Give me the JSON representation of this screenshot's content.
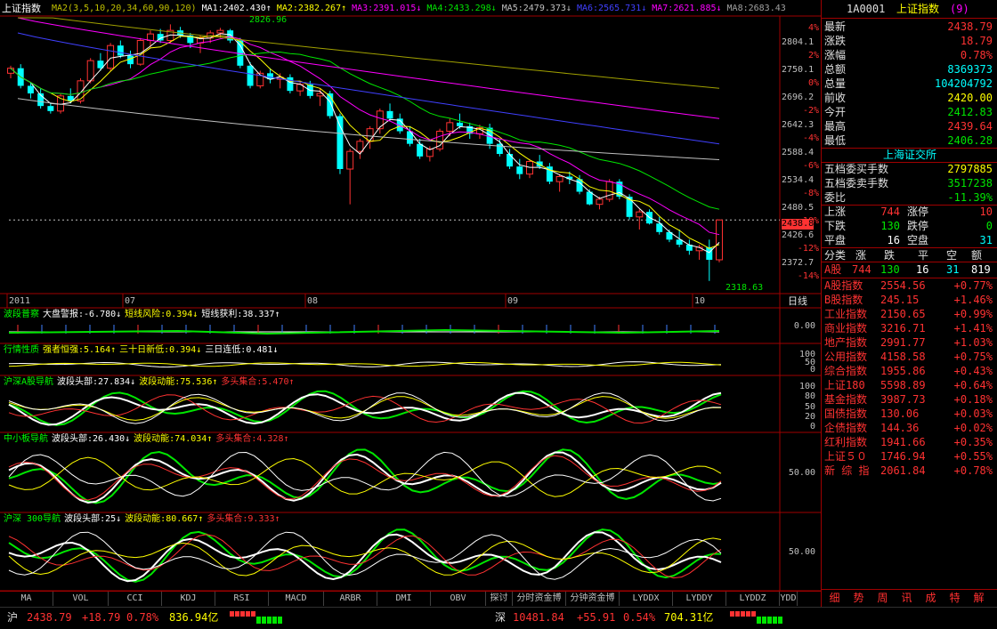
{
  "colors": {
    "up": "#ff3232",
    "down": "#00ffff",
    "green": "#00e600",
    "white": "#ffffff",
    "yellow": "#ffff00",
    "label": "#e0e0e0",
    "grid": "#a00000"
  },
  "header": {
    "title": "上证指数",
    "ma_legend": [
      {
        "text": "MA2(3,5,10,20,34,60,90,120)",
        "color": "#c0c000"
      },
      {
        "text": "MA1:2402.430↑",
        "color": "#ffffff"
      },
      {
        "text": "MA2:2382.267↑",
        "color": "#ffff00"
      },
      {
        "text": "MA3:2391.015↓",
        "color": "#ff00ff"
      },
      {
        "text": "MA4:2433.298↓",
        "color": "#00e600"
      },
      {
        "text": "MA5:2479.373↓",
        "color": "#c0c0c0"
      },
      {
        "text": "MA6:2565.731↓",
        "color": "#4040ff"
      },
      {
        "text": "MA7:2621.885↓",
        "color": "#ff00ff"
      },
      {
        "text": "MA8:2683.43",
        "color": "#a0a0a0"
      }
    ]
  },
  "price_axis": {
    "ticks": [
      {
        "price": "2804.1",
        "pct": "4%"
      },
      {
        "price": "2750.1",
        "pct": "2%"
      },
      {
        "price": "2696.2",
        "pct": "0%"
      },
      {
        "price": "2642.3",
        "pct": "-2%"
      },
      {
        "price": "2588.4",
        "pct": "-4%"
      },
      {
        "price": "2534.4",
        "pct": "-6%"
      },
      {
        "price": "2480.5",
        "pct": "-8%"
      },
      {
        "price": "2426.6",
        "pct": "-10%"
      },
      {
        "price": "2372.7",
        "pct": "-12%"
      },
      {
        "pct": "-14%"
      }
    ],
    "current": "2438.8",
    "high_label": "2826.96",
    "low_label": "2318.63"
  },
  "date_axis": [
    "2011",
    "07",
    "08",
    "09",
    "10"
  ],
  "period": "日线",
  "subcharts": [
    {
      "id": "wave",
      "legend": [
        {
          "text": "波段普察",
          "color": "#00ff00"
        },
        {
          "text": "大盘警报:-6.780↓",
          "color": "#ffffff"
        },
        {
          "text": "短线风险:0.394↓",
          "color": "#ffff00"
        },
        {
          "text": "短线获利:38.337↑",
          "color": "#ffffff"
        }
      ],
      "axis": [
        "0.00"
      ]
    },
    {
      "id": "nature",
      "legend": [
        {
          "text": "行情性质",
          "color": "#00ff00"
        },
        {
          "text": "强者恒强:5.164↑",
          "color": "#ffff00"
        },
        {
          "text": "三十日新低:0.394↓",
          "color": "#ffff00"
        },
        {
          "text": "三日连低:0.481↓",
          "color": "#ffffff"
        }
      ],
      "axis": [
        "100",
        "50",
        "0"
      ]
    },
    {
      "id": "hs_a",
      "legend": [
        {
          "text": "沪深A股导航",
          "color": "#00ff00"
        },
        {
          "text": "波段头部:27.834↓",
          "color": "#ffffff"
        },
        {
          "text": "波段动能:75.536↑",
          "color": "#ffff00"
        },
        {
          "text": "多头集合:5.470↑",
          "color": "#ff3232"
        }
      ],
      "axis": [
        "100",
        "80",
        "50",
        "20",
        "0"
      ]
    },
    {
      "id": "sme",
      "legend": [
        {
          "text": "中小板导航",
          "color": "#00ff00"
        },
        {
          "text": "波段头部:26.430↓",
          "color": "#ffffff"
        },
        {
          "text": "波段动能:74.034↑",
          "color": "#ffff00"
        },
        {
          "text": "多头集合:4.328↑",
          "color": "#ff3232"
        }
      ],
      "axis": [
        "50.00"
      ]
    },
    {
      "id": "hs300",
      "legend": [
        {
          "text": "沪深 300导航",
          "color": "#00ff00"
        },
        {
          "text": "波段头部:25↓",
          "color": "#ffffff"
        },
        {
          "text": "波段动能:80.667↑",
          "color": "#ffff00"
        },
        {
          "text": "多头集合:9.333↑",
          "color": "#ff3232"
        }
      ],
      "axis": [
        "50.00"
      ]
    }
  ],
  "bottom_tabs": [
    "MA",
    "VOL",
    "CCI",
    "KDJ",
    "RSI",
    "MACD",
    "ARBR",
    "DMI",
    "OBV",
    "探讨",
    "分时资金博",
    "分钟资金博",
    "LYDDX",
    "LYDDY",
    "LYDDZ",
    "YDD"
  ],
  "right_panel": {
    "code": "1A0001",
    "name": "上证指数",
    "badge": "(9)",
    "quote": [
      {
        "label": "最新",
        "value": "2438.79",
        "color": "#ff3232"
      },
      {
        "label": "涨跌",
        "value": "18.79",
        "color": "#ff3232"
      },
      {
        "label": "涨幅",
        "value": "0.78%",
        "color": "#ff3232"
      },
      {
        "label": "总额",
        "value": "8369373",
        "color": "#00ffff"
      },
      {
        "label": "总量",
        "value": "104204792",
        "color": "#00ffff"
      },
      {
        "label": "前收",
        "value": "2420.00",
        "color": "#ffff00"
      },
      {
        "label": "今开",
        "value": "2412.83",
        "color": "#00e600"
      },
      {
        "label": "最高",
        "value": "2439.64",
        "color": "#ff3232"
      },
      {
        "label": "最低",
        "value": "2406.28",
        "color": "#00e600"
      }
    ],
    "exchange_title": "上海证交所",
    "orders": [
      {
        "label": "五档委买手数",
        "value": "2797885",
        "color": "#ffff00"
      },
      {
        "label": "五档委卖手数",
        "value": "3517238",
        "color": "#00e600"
      },
      {
        "label": "委比",
        "value": "-11.39%",
        "color": "#00e600"
      }
    ],
    "breadth": [
      {
        "l1": "上涨",
        "v1": "744",
        "l2": "涨停",
        "v2": "10",
        "c1": "#ff3232",
        "c2": "#ff3232"
      },
      {
        "l1": "下跌",
        "v1": "130",
        "l2": "跌停",
        "v2": "0",
        "c1": "#00e600",
        "c2": "#00e600"
      },
      {
        "l1": "平盘",
        "v1": "16",
        "l2": "空盘",
        "v2": "31",
        "c1": "#ffffff",
        "c2": "#00ffff"
      }
    ],
    "class_header": [
      "分类",
      "涨",
      "跌",
      "平",
      "空",
      "额"
    ],
    "class_row": {
      "name": "A股",
      "up": "744",
      "down": "130",
      "flat": "16",
      "empty": "31",
      "amt": "819"
    },
    "indices": [
      {
        "name": "A股指数",
        "value": "2554.56",
        "chg": "+0.77%"
      },
      {
        "name": "B股指数",
        "value": "245.15",
        "chg": "+1.46%"
      },
      {
        "name": "工业指数",
        "value": "2150.65",
        "chg": "+0.99%"
      },
      {
        "name": "商业指数",
        "value": "3216.71",
        "chg": "+1.41%"
      },
      {
        "name": "地产指数",
        "value": "2991.77",
        "chg": "+1.03%"
      },
      {
        "name": "公用指数",
        "value": "4158.58",
        "chg": "+0.75%"
      },
      {
        "name": "综合指数",
        "value": "1955.86",
        "chg": "+0.43%"
      },
      {
        "name": "上证180",
        "value": "5598.89",
        "chg": "+0.64%"
      },
      {
        "name": "基金指数",
        "value": "3987.73",
        "chg": "+0.18%"
      },
      {
        "name": "国债指数",
        "value": "130.06",
        "chg": "+0.03%"
      },
      {
        "name": "企债指数",
        "value": "144.36",
        "chg": "+0.02%"
      },
      {
        "name": "红利指数",
        "value": "1941.66",
        "chg": "+0.35%"
      },
      {
        "name": "上证５０",
        "value": "1746.94",
        "chg": "+0.55%"
      },
      {
        "name": "新 综 指",
        "value": "2061.84",
        "chg": "+0.78%"
      }
    ],
    "tabs": [
      "细",
      "势",
      "周",
      "讯",
      "成",
      "特",
      "解"
    ]
  },
  "status": {
    "sh": {
      "label": "沪",
      "price": "2438.79",
      "chg": "+18.79",
      "pct": "0.78%",
      "amount": "836.94亿"
    },
    "sz": {
      "label": "深",
      "price": "10481.84",
      "chg": "+55.91",
      "pct": "0.54%",
      "amount": "704.31亿"
    }
  },
  "chart_data": {
    "type": "candlestick",
    "title": "上证指数",
    "ylim": [
      2300,
      2840
    ],
    "dates": [
      "2011",
      "07",
      "08",
      "09",
      "10"
    ],
    "ohlc": [
      [
        2730,
        2745,
        2720,
        2740
      ],
      [
        2740,
        2748,
        2700,
        2705
      ],
      [
        2705,
        2712,
        2680,
        2690
      ],
      [
        2690,
        2700,
        2660,
        2665
      ],
      [
        2665,
        2672,
        2650,
        2655
      ],
      [
        2655,
        2690,
        2650,
        2685
      ],
      [
        2685,
        2700,
        2670,
        2675
      ],
      [
        2675,
        2720,
        2670,
        2715
      ],
      [
        2715,
        2760,
        2710,
        2755
      ],
      [
        2755,
        2770,
        2735,
        2740
      ],
      [
        2740,
        2790,
        2735,
        2785
      ],
      [
        2785,
        2795,
        2760,
        2765
      ],
      [
        2765,
        2775,
        2740,
        2748
      ],
      [
        2748,
        2800,
        2745,
        2795
      ],
      [
        2795,
        2815,
        2780,
        2808
      ],
      [
        2808,
        2818,
        2790,
        2795
      ],
      [
        2795,
        2827,
        2790,
        2815
      ],
      [
        2815,
        2822,
        2800,
        2805
      ],
      [
        2805,
        2810,
        2780,
        2790
      ],
      [
        2790,
        2805,
        2770,
        2800
      ],
      [
        2800,
        2815,
        2790,
        2810
      ],
      [
        2810,
        2820,
        2800,
        2815
      ],
      [
        2815,
        2818,
        2790,
        2795
      ],
      [
        2795,
        2800,
        2740,
        2745
      ],
      [
        2745,
        2752,
        2700,
        2705
      ],
      [
        2705,
        2735,
        2700,
        2730
      ],
      [
        2730,
        2740,
        2710,
        2718
      ],
      [
        2718,
        2730,
        2700,
        2722
      ],
      [
        2722,
        2728,
        2690,
        2695
      ],
      [
        2695,
        2712,
        2685,
        2708
      ],
      [
        2708,
        2715,
        2680,
        2685
      ],
      [
        2685,
        2700,
        2665,
        2690
      ],
      [
        2690,
        2695,
        2640,
        2645
      ],
      [
        2645,
        2650,
        2530,
        2540
      ],
      [
        2540,
        2580,
        2470,
        2575
      ],
      [
        2575,
        2600,
        2560,
        2595
      ],
      [
        2595,
        2625,
        2580,
        2620
      ],
      [
        2620,
        2660,
        2610,
        2655
      ],
      [
        2655,
        2670,
        2635,
        2640
      ],
      [
        2640,
        2650,
        2610,
        2615
      ],
      [
        2615,
        2625,
        2585,
        2590
      ],
      [
        2590,
        2600,
        2560,
        2565
      ],
      [
        2565,
        2585,
        2555,
        2580
      ],
      [
        2580,
        2620,
        2575,
        2615
      ],
      [
        2615,
        2640,
        2605,
        2632
      ],
      [
        2632,
        2650,
        2620,
        2625
      ],
      [
        2625,
        2632,
        2600,
        2610
      ],
      [
        2610,
        2628,
        2600,
        2622
      ],
      [
        2622,
        2630,
        2580,
        2590
      ],
      [
        2590,
        2600,
        2565,
        2570
      ],
      [
        2570,
        2580,
        2540,
        2545
      ],
      [
        2545,
        2560,
        2520,
        2530
      ],
      [
        2530,
        2560,
        2522,
        2555
      ],
      [
        2555,
        2568,
        2540,
        2545
      ],
      [
        2545,
        2552,
        2510,
        2515
      ],
      [
        2515,
        2530,
        2495,
        2525
      ],
      [
        2525,
        2535,
        2510,
        2520
      ],
      [
        2520,
        2528,
        2490,
        2495
      ],
      [
        2495,
        2500,
        2468,
        2470
      ],
      [
        2470,
        2485,
        2460,
        2480
      ],
      [
        2480,
        2520,
        2475,
        2515
      ],
      [
        2515,
        2520,
        2480,
        2485
      ],
      [
        2485,
        2490,
        2440,
        2445
      ],
      [
        2445,
        2460,
        2420,
        2455
      ],
      [
        2455,
        2460,
        2430,
        2432
      ],
      [
        2432,
        2445,
        2410,
        2415
      ],
      [
        2415,
        2420,
        2395,
        2400
      ],
      [
        2400,
        2420,
        2385,
        2390
      ],
      [
        2390,
        2400,
        2370,
        2378
      ],
      [
        2378,
        2390,
        2360,
        2385
      ],
      [
        2385,
        2400,
        2318,
        2360
      ],
      [
        2360,
        2440,
        2355,
        2439
      ]
    ]
  }
}
